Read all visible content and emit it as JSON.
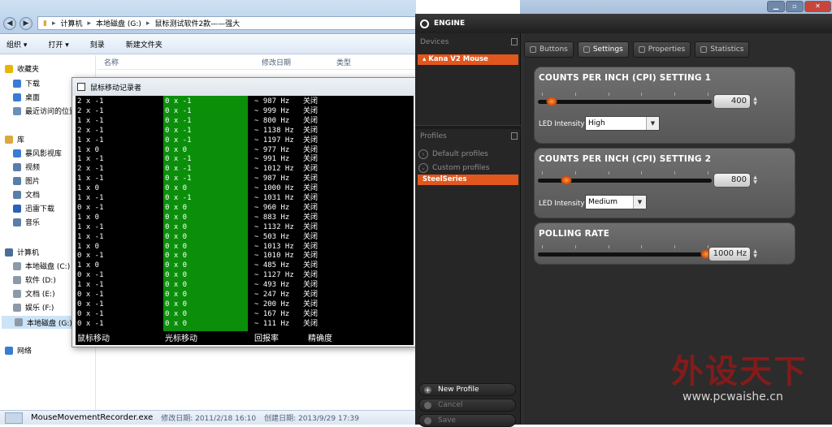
{
  "explorer": {
    "breadcrumbs": [
      "计算机",
      "本地磁盘 (G:)",
      "鼠标测试软件2款——强大"
    ],
    "toolbar": [
      "组织 ▾",
      "打开 ▾",
      "刻录",
      "新建文件夹"
    ],
    "columns": [
      "名称",
      "修改日期",
      "类型"
    ],
    "nav": [
      {
        "label": "收藏夹",
        "icon": "star-icon",
        "color": "#e8b600"
      },
      {
        "label": "下载",
        "icon": "download-folder-icon",
        "color": "#3a7bd5"
      },
      {
        "label": "桌面",
        "icon": "desktop-icon",
        "color": "#3a7bd5"
      },
      {
        "label": "最近访问的位置",
        "icon": "recent-places-icon",
        "color": "#6b8fb8"
      },
      {
        "label": "库",
        "icon": "library-icon",
        "color": "#d9a93d"
      },
      {
        "label": "暴风影视库",
        "icon": "video-library-icon",
        "color": "#3a7bd5"
      },
      {
        "label": "视频",
        "icon": "video-icon",
        "color": "#5a7ea8"
      },
      {
        "label": "图片",
        "icon": "picture-icon",
        "color": "#5a7ea8"
      },
      {
        "label": "文档",
        "icon": "document-icon",
        "color": "#5a7ea8"
      },
      {
        "label": "迅雷下载",
        "icon": "thunder-download-icon",
        "color": "#2a62b8"
      },
      {
        "label": "音乐",
        "icon": "music-icon",
        "color": "#5a7ea8"
      },
      {
        "label": "计算机",
        "icon": "computer-icon",
        "color": "#4a6e96"
      },
      {
        "label": "本地磁盘 (C:)",
        "icon": "drive-icon",
        "color": "#8c9aa8"
      },
      {
        "label": "软件 (D:)",
        "icon": "drive-icon",
        "color": "#8c9aa8"
      },
      {
        "label": "文档 (E:)",
        "icon": "drive-icon",
        "color": "#8c9aa8"
      },
      {
        "label": "娱乐 (F:)",
        "icon": "drive-icon",
        "color": "#8c9aa8"
      },
      {
        "label": "本地磁盘 (G:)",
        "icon": "drive-icon",
        "color": "#8c9aa8"
      },
      {
        "label": "网络",
        "icon": "network-icon",
        "color": "#3a7bd5"
      }
    ],
    "status": {
      "filename": "MouseMovementRecorder.exe",
      "modified": "修改日期: 2011/2/18 16:10",
      "created": "创建日期: 2013/9/29 17:39"
    }
  },
  "recorder": {
    "title": "鼠标移动记录者",
    "rows": [
      [
        "2 x -1",
        "0 x -1",
        "~ 987 Hz",
        "关闭"
      ],
      [
        "2 x -1",
        "0 x -1",
        "~ 999 Hz",
        "关闭"
      ],
      [
        "1 x -1",
        "0 x -1",
        "~ 800 Hz",
        "关闭"
      ],
      [
        "2 x -1",
        "0 x -1",
        "~ 1138 Hz",
        "关闭"
      ],
      [
        "1 x -1",
        "0 x -1",
        "~ 1197 Hz",
        "关闭"
      ],
      [
        "1 x 0",
        "0 x 0",
        "~ 977 Hz",
        "关闭"
      ],
      [
        "1 x -1",
        "0 x -1",
        "~ 991 Hz",
        "关闭"
      ],
      [
        "2 x -1",
        "0 x -1",
        "~ 1012 Hz",
        "关闭"
      ],
      [
        "1 x -1",
        "0 x -1",
        "~ 987 Hz",
        "关闭"
      ],
      [
        "1 x 0",
        "0 x 0",
        "~ 1000 Hz",
        "关闭"
      ],
      [
        "1 x -1",
        "0 x -1",
        "~ 1031 Hz",
        "关闭"
      ],
      [
        "0 x -1",
        "0 x 0",
        "~ 960 Hz",
        "关闭"
      ],
      [
        "1 x 0",
        "0 x 0",
        "~ 883 Hz",
        "关闭"
      ],
      [
        "1 x -1",
        "0 x 0",
        "~ 1132 Hz",
        "关闭"
      ],
      [
        "1 x -1",
        "0 x 0",
        "~ 503 Hz",
        "关闭"
      ],
      [
        "1 x 0",
        "0 x 0",
        "~ 1013 Hz",
        "关闭"
      ],
      [
        "0 x -1",
        "0 x 0",
        "~ 1010 Hz",
        "关闭"
      ],
      [
        "1 x 0",
        "0 x 0",
        "~ 485 Hz",
        "关闭"
      ],
      [
        "0 x -1",
        "0 x 0",
        "~ 1127 Hz",
        "关闭"
      ],
      [
        "1 x -1",
        "0 x 0",
        "~ 493 Hz",
        "关闭"
      ],
      [
        "0 x -1",
        "0 x 0",
        "~ 247 Hz",
        "关闭"
      ],
      [
        "0 x -1",
        "0 x 0",
        "~ 200 Hz",
        "关闭"
      ],
      [
        "0 x -1",
        "0 x 0",
        "~ 167 Hz",
        "关闭"
      ],
      [
        "0 x -1",
        "0 x 0",
        "~ 111 Hz",
        "关闭"
      ]
    ],
    "footer": [
      "鼠标移动",
      "光标移动",
      "回报率",
      "精确度"
    ]
  },
  "engine": {
    "title": "ENGINE",
    "devices_label": "Devices",
    "device": "Kana V2 Mouse",
    "profiles_label": "Profiles",
    "profile_groups": [
      "Default profiles",
      "Custom profiles"
    ],
    "active_profile": "SteelSeries",
    "actions": [
      "New Profile",
      "Cancel",
      "Save"
    ],
    "tabs": [
      "Buttons",
      "Settings",
      "Properties",
      "Statistics"
    ],
    "active_tab": "Settings",
    "cpi1": {
      "title": "COUNTS PER INCH (CPI) SETTING 1",
      "value": "400",
      "led_label": "LED Intensity",
      "led": "High",
      "level": 0.05
    },
    "cpi2": {
      "title": "COUNTS PER INCH (CPI) SETTING 2",
      "value": "800",
      "led_label": "LED Intensity",
      "led": "Medium",
      "level": 0.14
    },
    "polling": {
      "title": "POLLING RATE",
      "value": "1000 Hz",
      "level": 1.0
    },
    "accent": "#e1571d"
  },
  "window": {
    "close_tooltip": "关闭"
  },
  "watermark": {
    "text": "外设天下",
    "url": "www.pcwaishe.cn"
  }
}
